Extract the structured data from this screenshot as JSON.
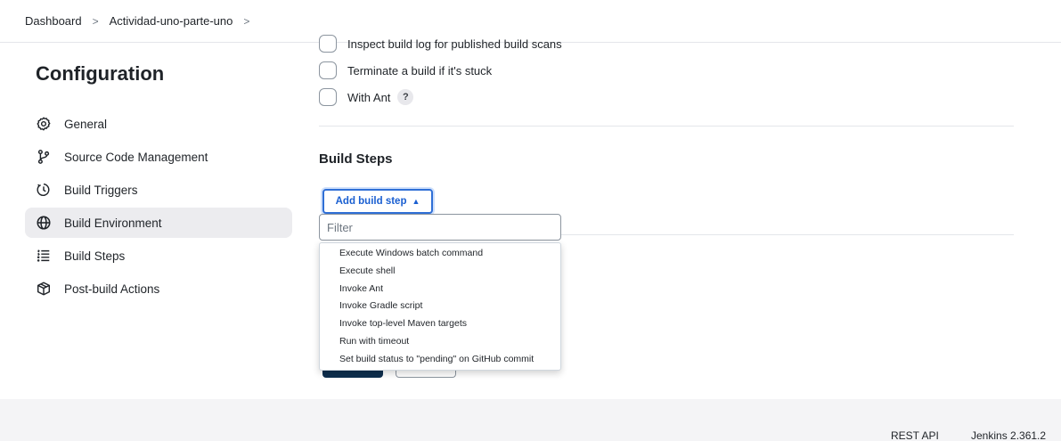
{
  "breadcrumb": {
    "items": [
      "Dashboard",
      "Actividad-uno-parte-uno"
    ],
    "separator": ">"
  },
  "sidebar": {
    "title": "Configuration",
    "items": [
      {
        "label": "General",
        "icon": "gear-icon"
      },
      {
        "label": "Source Code Management",
        "icon": "branch-icon"
      },
      {
        "label": "Build Triggers",
        "icon": "clock-icon"
      },
      {
        "label": "Build Environment",
        "icon": "globe-icon",
        "active": true
      },
      {
        "label": "Build Steps",
        "icon": "list-icon"
      },
      {
        "label": "Post-build Actions",
        "icon": "package-icon"
      }
    ]
  },
  "main": {
    "options": [
      {
        "label": "Inspect build log for published build scans",
        "checked": false
      },
      {
        "label": "Terminate a build if it's stuck",
        "checked": false
      },
      {
        "label": "With Ant",
        "checked": false,
        "help": "?"
      }
    ],
    "build_steps_title": "Build Steps",
    "add_build_step_label": "Add build step",
    "add_build_step_caret": "▲",
    "filter_placeholder": "Filter",
    "dropdown_items": [
      "Execute Windows batch command",
      "Execute shell",
      "Invoke Ant",
      "Invoke Gradle script",
      "Invoke top-level Maven targets",
      "Run with timeout",
      "Set build status to \"pending\" on GitHub commit"
    ]
  },
  "footer": {
    "rest_api": "REST API",
    "version": "Jenkins 2.361.2"
  },
  "colors": {
    "accent": "#2f6fd6",
    "active_bg": "#ececef",
    "footer_bg": "#f4f4f6"
  }
}
